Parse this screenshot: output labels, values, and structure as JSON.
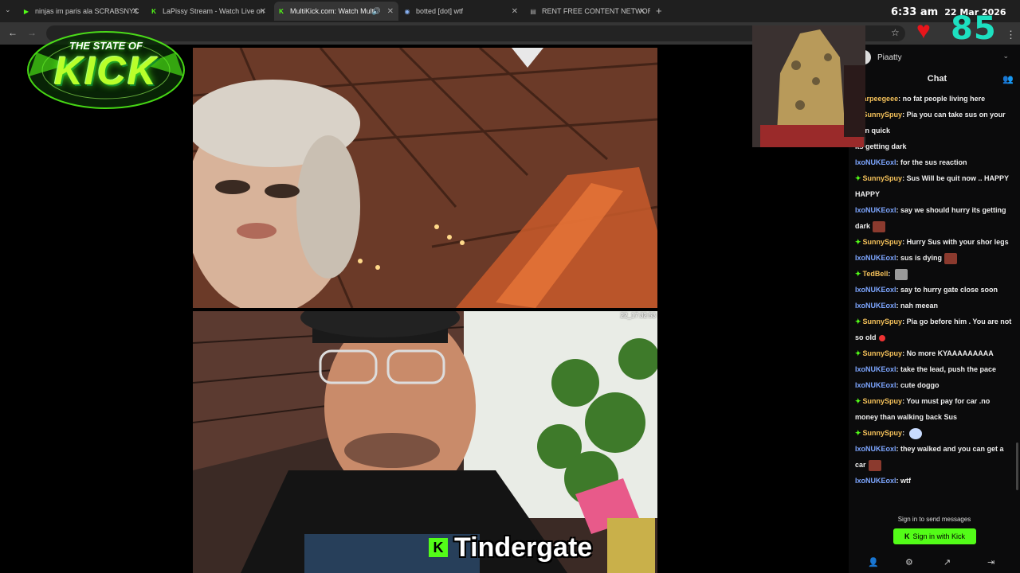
{
  "tabs": [
    {
      "label": "ninjas im paris ala SCRABSNYC",
      "icon": "play-icon"
    },
    {
      "label": "LaPissy Stream - Watch Live on",
      "icon": "kick-icon"
    },
    {
      "label": "MultiKick.com: Watch Multi",
      "icon": "kick-icon",
      "active": true
    },
    {
      "label": "botted [dot] wtf",
      "icon": "globe-icon"
    },
    {
      "label": "RENT FREE CONTENT NETWOR",
      "icon": "page-icon"
    }
  ],
  "clock": {
    "time": "6:33 am",
    "date": "22 Mar 2026"
  },
  "viewer_count": "85",
  "logo": {
    "top": "THE STATE OF",
    "main": "KICK"
  },
  "stream": {
    "timestamp": "22_17:32:53",
    "caption": "Tindergate",
    "caption_badge": "K"
  },
  "chat": {
    "username": "Piaatty",
    "title": "Chat",
    "messages": [
      {
        "badge": "✦",
        "user": "arpeegeee",
        "color": "#f4c15a",
        "text": "no fat people living here"
      },
      {
        "badge": "✦",
        "user": "SunnySpuy",
        "color": "#f4c15a",
        "text": "Pia you can take sus on your own quick"
      },
      {
        "badge": "",
        "user": "",
        "color": "#fff",
        "text": "its getting dark"
      },
      {
        "badge": "",
        "user": "IxoNUKEoxl",
        "color": "#7da6ff",
        "text": "for the sus reaction"
      },
      {
        "badge": "✦",
        "user": "SunnySpuy",
        "color": "#f4c15a",
        "text": "Sus Will be quit now .. HAPPY HAPPY"
      },
      {
        "badge": "",
        "user": "IxoNUKEoxl",
        "color": "#7da6ff",
        "text": "say we should hurry its getting dark",
        "emote": "emote"
      },
      {
        "badge": "✦",
        "user": "SunnySpuy",
        "color": "#f4c15a",
        "text": "Hurry Sus with your shor legs"
      },
      {
        "badge": "",
        "user": "IxoNUKEoxl",
        "color": "#7da6ff",
        "text": "sus is dying",
        "emote": "emote"
      },
      {
        "badge": "✦",
        "user": "TedBell",
        "color": "#f4c15a",
        "text": "",
        "emote": "cat"
      },
      {
        "badge": "",
        "user": "IxoNUKEoxl",
        "color": "#7da6ff",
        "text": "say to hurry gate close soon"
      },
      {
        "badge": "",
        "user": "IxoNUKEoxl",
        "color": "#7da6ff",
        "text": "nah meean"
      },
      {
        "badge": "✦",
        "user": "SunnySpuy",
        "color": "#f4c15a",
        "text": "Pia go before him . You are not so old",
        "emote": "red"
      },
      {
        "badge": "✦",
        "user": "SunnySpuy",
        "color": "#f4c15a",
        "text": "No more KYAAAAAAAAA"
      },
      {
        "badge": "",
        "user": "IxoNUKEoxl",
        "color": "#7da6ff",
        "text": "take the lead, push the pace"
      },
      {
        "badge": "",
        "user": "IxoNUKEoxl",
        "color": "#7da6ff",
        "text": "cute doggo"
      },
      {
        "badge": "✦",
        "user": "SunnySpuy",
        "color": "#f4c15a",
        "text": "You must pay for car .no money than walking back Sus"
      },
      {
        "badge": "✦",
        "user": "SunnySpuy",
        "color": "#f4c15a",
        "text": "",
        "emote": "cloud"
      },
      {
        "badge": "",
        "user": "IxoNUKEoxl",
        "color": "#7da6ff",
        "text": "they walked and you can get a car",
        "emote": "emote"
      },
      {
        "badge": "",
        "user": "IxoNUKEoxl",
        "color": "#7da6ff",
        "text": "wtf"
      }
    ],
    "signin_prompt": "Sign in to send messages",
    "signin_button": "Sign in with Kick"
  }
}
